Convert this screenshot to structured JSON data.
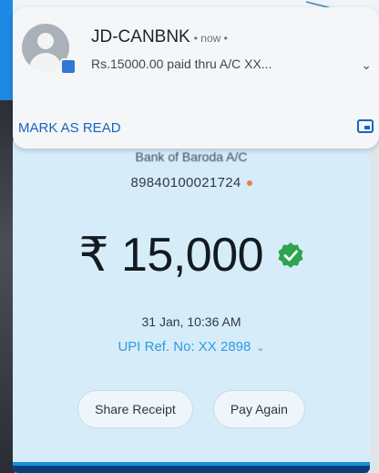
{
  "notification": {
    "sender": "JD-CANBNK",
    "meta": "• now •",
    "preview": "Rs.15000.00 paid thru A/C XX...",
    "action_label": "MARK AS READ",
    "expand_icon": "chevron-down-icon",
    "right_icon": "open-in-app-icon"
  },
  "payment": {
    "to_line": "Bank of Baroda A/C",
    "account_number": "89840100021724",
    "amount": "₹ 15,000",
    "datetime": "31 Jan, 10:36 AM",
    "upi_ref": "UPI Ref. No: XX 2898",
    "buttons": [
      "Share Receipt",
      "Pay Again"
    ],
    "colors": {
      "card_bg": "#d6ecf8",
      "accent": "#2f9ae4",
      "verified": "#2ea44f"
    }
  }
}
